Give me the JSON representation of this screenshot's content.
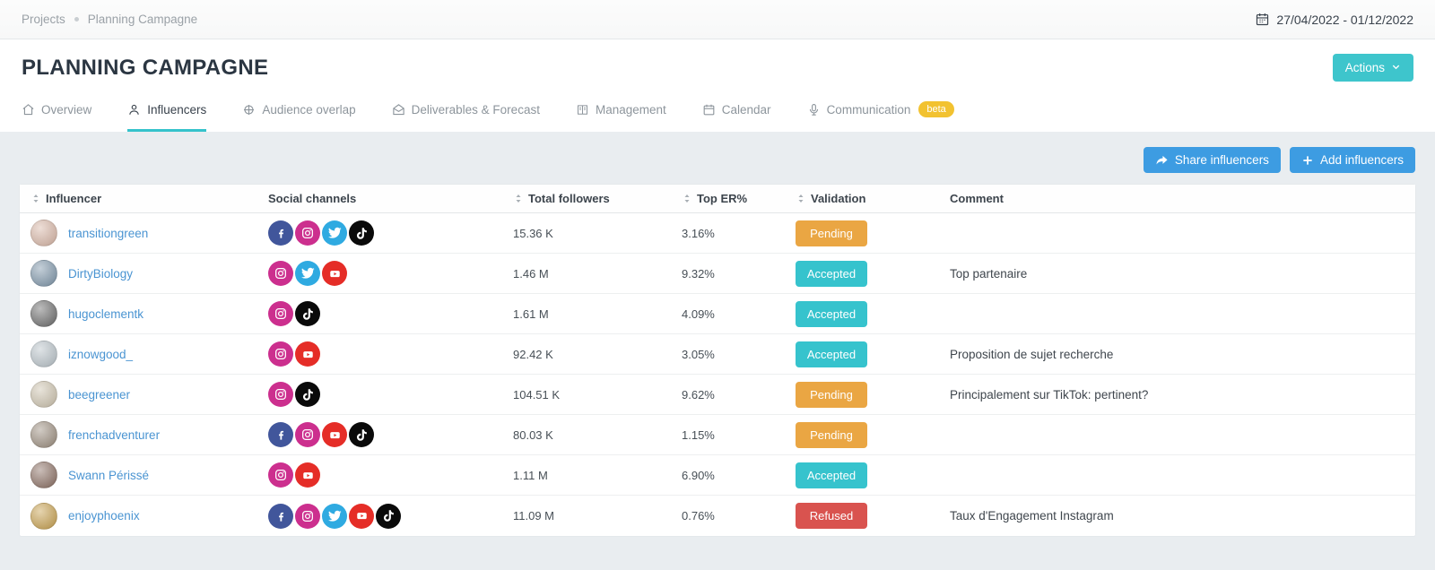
{
  "breadcrumb": {
    "projects": "Projects",
    "current": "Planning Campagne"
  },
  "date_range": "27/04/2022 - 01/12/2022",
  "header": {
    "title": "PLANNING CAMPAGNE",
    "actions_label": "Actions"
  },
  "tabs": [
    {
      "label": "Overview",
      "icon": "home-icon",
      "active": false
    },
    {
      "label": "Influencers",
      "icon": "user-icon",
      "active": true
    },
    {
      "label": "Audience overlap",
      "icon": "target-icon",
      "active": false
    },
    {
      "label": "Deliverables & Forecast",
      "icon": "envelope-icon",
      "active": false
    },
    {
      "label": "Management",
      "icon": "book-icon",
      "active": false
    },
    {
      "label": "Calendar",
      "icon": "calendar-icon",
      "active": false
    },
    {
      "label": "Communication",
      "icon": "microphone-icon",
      "active": false,
      "badge": "beta"
    }
  ],
  "toolbar": {
    "share_label": "Share influencers",
    "add_label": "Add influencers"
  },
  "table": {
    "columns": [
      {
        "label": "Influencer",
        "sortable": true
      },
      {
        "label": "Social channels",
        "sortable": false
      },
      {
        "label": "Total followers",
        "sortable": true
      },
      {
        "label": "Top ER%",
        "sortable": true
      },
      {
        "label": "Validation",
        "sortable": true
      },
      {
        "label": "Comment",
        "sortable": false
      }
    ],
    "rows": [
      {
        "influencer": "transitiongreen",
        "avatar_color": "#d8b6a6",
        "channels": [
          "facebook",
          "instagram",
          "twitter",
          "tiktok"
        ],
        "followers": "15.36 K",
        "top_er": "3.16%",
        "validation": "Pending",
        "comment": ""
      },
      {
        "influencer": "DirtyBiology",
        "avatar_color": "#7d95a9",
        "channels": [
          "instagram",
          "twitter",
          "youtube"
        ],
        "followers": "1.46 M",
        "top_er": "9.32%",
        "validation": "Accepted",
        "comment": "Top partenaire"
      },
      {
        "influencer": "hugoclementk",
        "avatar_color": "#6b6b6b",
        "channels": [
          "instagram",
          "tiktok"
        ],
        "followers": "1.61 M",
        "top_er": "4.09%",
        "validation": "Accepted",
        "comment": ""
      },
      {
        "influencer": "iznowgood_",
        "avatar_color": "#b9c3c9",
        "channels": [
          "instagram",
          "youtube"
        ],
        "followers": "92.42 K",
        "top_er": "3.05%",
        "validation": "Accepted",
        "comment": "Proposition de sujet recherche"
      },
      {
        "influencer": "beegreener",
        "avatar_color": "#cdc3ae",
        "channels": [
          "instagram",
          "tiktok"
        ],
        "followers": "104.51 K",
        "top_er": "9.62%",
        "validation": "Pending",
        "comment": "Principalement sur TikTok: pertinent?"
      },
      {
        "influencer": "frenchadventurer",
        "avatar_color": "#9b8d7e",
        "channels": [
          "facebook",
          "instagram",
          "youtube",
          "tiktok"
        ],
        "followers": "80.03 K",
        "top_er": "1.15%",
        "validation": "Pending",
        "comment": ""
      },
      {
        "influencer": "Swann Périssé",
        "avatar_color": "#8a6e62",
        "channels": [
          "instagram",
          "youtube"
        ],
        "followers": "1.11 M",
        "top_er": "6.90%",
        "validation": "Accepted",
        "comment": ""
      },
      {
        "influencer": "enjoyphoenix",
        "avatar_color": "#c7a04e",
        "channels": [
          "facebook",
          "instagram",
          "twitter",
          "youtube",
          "tiktok"
        ],
        "followers": "11.09 M",
        "top_er": "0.76%",
        "validation": "Refused",
        "comment": "Taux d'Engagement Instagram"
      }
    ]
  },
  "colors": {
    "accent_teal": "#3ec5cc",
    "primary_blue": "#3d9ce2",
    "pending": "#eaa643",
    "accepted": "#36c3cd",
    "refused": "#d9534f",
    "beta_badge": "#f2c230",
    "link_blue": "#4a94d2",
    "facebook": "#41569b",
    "instagram": "#cc2f8e",
    "twitter": "#2faae1",
    "youtube": "#e52d27",
    "tiktok": "#0a0a0a"
  }
}
